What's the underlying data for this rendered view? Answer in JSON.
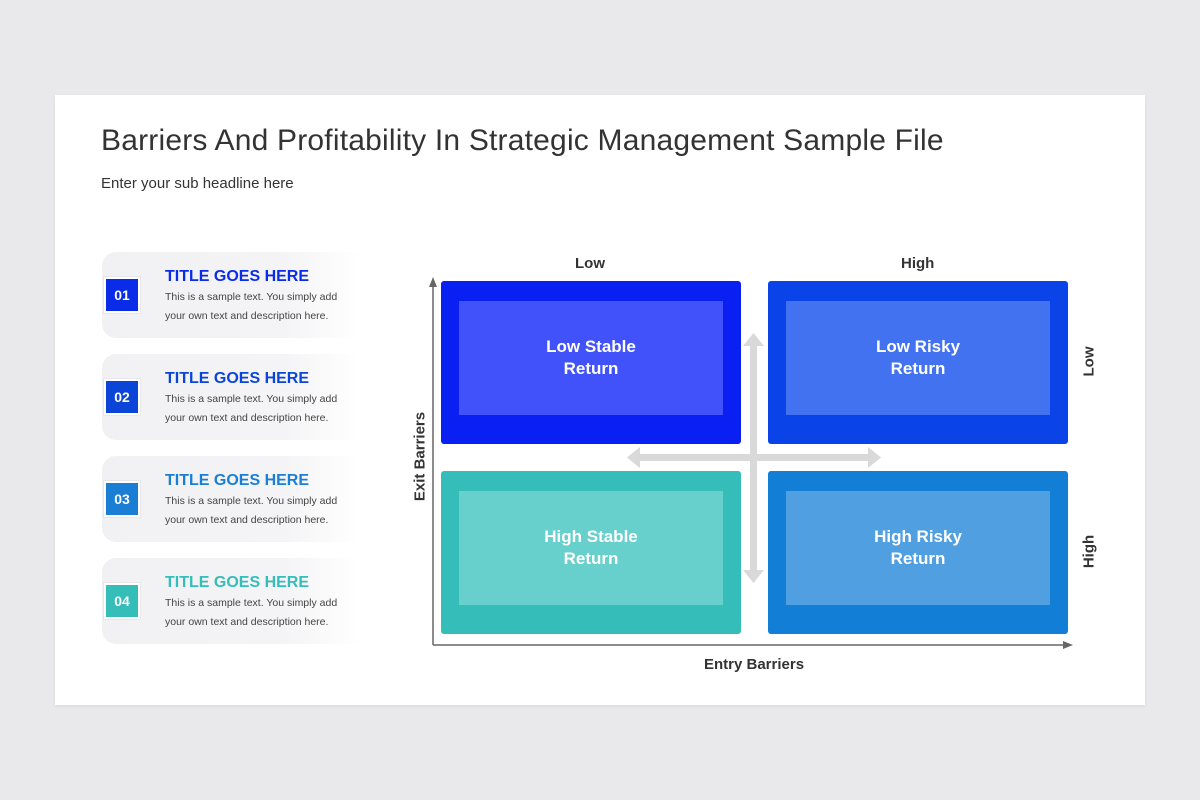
{
  "header": {
    "title": "Barriers And Profitability In Strategic Management Sample File",
    "subtitle": "Enter your sub headline here"
  },
  "list": [
    {
      "number": "01",
      "title": "TITLE GOES HERE",
      "text": "This is a sample text. You simply add your own text and description here.",
      "color": "#0a2be8"
    },
    {
      "number": "02",
      "title": "TITLE GOES HERE",
      "text": "This is a sample text. You simply add your own text and description here.",
      "color": "#0b45d8"
    },
    {
      "number": "03",
      "title": "TITLE GOES HERE",
      "text": "This is a sample text. You simply add your own text and description here.",
      "color": "#1a7fd4"
    },
    {
      "number": "04",
      "title": "TITLE GOES HERE",
      "text": "This is a sample text. You simply add your own text and description here.",
      "color": "#34bdb9"
    }
  ],
  "matrix": {
    "column_labels": [
      "Low",
      "High"
    ],
    "row_labels": [
      "Low",
      "High"
    ],
    "x_axis_label": "Entry Barriers",
    "y_axis_label": "Exit Barriers",
    "quadrants": [
      {
        "label_line1": "Low Stable",
        "label_line2": "Return",
        "outer_color": "#0a1ff2",
        "inner_color": "#4252fb"
      },
      {
        "label_line1": "Low Risky",
        "label_line2": "Return",
        "outer_color": "#0a44e8",
        "inner_color": "#4272ef"
      },
      {
        "label_line1": "High Stable",
        "label_line2": "Return",
        "outer_color": "#35bdba",
        "inner_color": "#68d0cc"
      },
      {
        "label_line1": "High Risky",
        "label_line2": "Return",
        "outer_color": "#127ed6",
        "inner_color": "#509fe0"
      }
    ],
    "arrow_color": "#d9d9d9",
    "axis_color": "#666666"
  }
}
